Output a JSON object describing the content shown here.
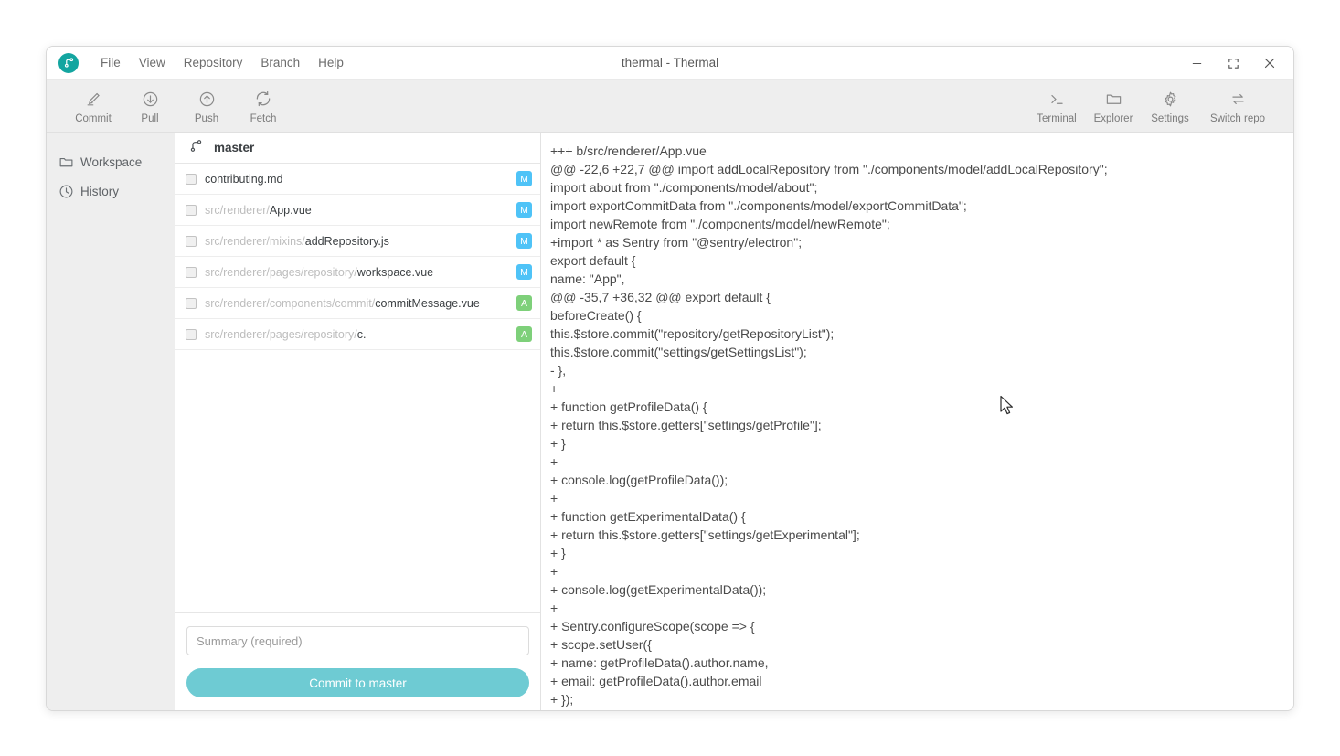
{
  "window": {
    "title": "thermal - Thermal",
    "logo_icon": "git-branch-logo-icon",
    "minimize_label": "–",
    "maximize_label": "maximize-icon",
    "close_label": "×"
  },
  "menubar": {
    "items": [
      {
        "label": "File"
      },
      {
        "label": "View"
      },
      {
        "label": "Repository"
      },
      {
        "label": "Branch"
      },
      {
        "label": "Help"
      }
    ]
  },
  "toolbar": {
    "left": [
      {
        "label": "Commit",
        "icon": "pencil-icon"
      },
      {
        "label": "Pull",
        "icon": "arrow-down-circle-icon"
      },
      {
        "label": "Push",
        "icon": "arrow-up-circle-icon"
      },
      {
        "label": "Fetch",
        "icon": "refresh-icon"
      }
    ],
    "right": [
      {
        "label": "Terminal",
        "icon": "terminal-icon"
      },
      {
        "label": "Explorer",
        "icon": "folder-icon"
      },
      {
        "label": "Settings",
        "icon": "gear-icon"
      },
      {
        "label": "Switch repo",
        "icon": "swap-arrows-icon"
      }
    ]
  },
  "sidebar": {
    "items": [
      {
        "label": "Workspace",
        "icon": "folder-icon"
      },
      {
        "label": "History",
        "icon": "clock-icon"
      }
    ]
  },
  "branch": {
    "icon": "git-branch-icon",
    "name": "master"
  },
  "files": [
    {
      "dir": "",
      "base": "contributing.md",
      "status": "M",
      "checked": false
    },
    {
      "dir": "src/renderer/",
      "base": "App.vue",
      "status": "M",
      "checked": false
    },
    {
      "dir": "src/renderer/mixins/",
      "base": "addRepository.js",
      "status": "M",
      "checked": false
    },
    {
      "dir": "src/renderer/pages/repository/",
      "base": "workspace.vue",
      "status": "M",
      "checked": false
    },
    {
      "dir": "src/renderer/components/commit/",
      "base": "commitMessage.vue",
      "status": "A",
      "checked": false
    },
    {
      "dir": "src/renderer/pages/repository/",
      "base": "c.",
      "status": "A",
      "checked": false
    }
  ],
  "commit": {
    "summary_value": "",
    "summary_placeholder": "Summary (required)",
    "button_label": "Commit to master"
  },
  "diff": {
    "lines": [
      "+++ b/src/renderer/App.vue",
      "@@ -22,6 +22,7 @@ import addLocalRepository from \"./components/model/addLocalRepository\";",
      "import about from \"./components/model/about\";",
      "import exportCommitData from \"./components/model/exportCommitData\";",
      "import newRemote from \"./components/model/newRemote\";",
      "+import * as Sentry from \"@sentry/electron\";",
      "export default {",
      "name: \"App\",",
      "@@ -35,7 +36,32 @@ export default {",
      "beforeCreate() {",
      "this.$store.commit(\"repository/getRepositoryList\");",
      "this.$store.commit(\"settings/getSettingsList\");",
      "- },",
      "+",
      "+ function getProfileData() {",
      "+ return this.$store.getters[\"settings/getProfile\"];",
      "+ }",
      "+",
      "+ console.log(getProfileData());",
      "+",
      "+ function getExperimentalData() {",
      "+ return this.$store.getters[\"settings/getExperimental\"];",
      "+ }",
      "+",
      "+ console.log(getExperimentalData());",
      "+",
      "+ Sentry.configureScope(scope => {",
      "+ scope.setUser({",
      "+ name: getProfileData().author.name,",
      "+ email: getProfileData().author.email",
      "+ });"
    ]
  },
  "colors": {
    "accent_teal": "#6ecbd3",
    "logo_teal": "#13a5a0",
    "badge_modified": "#4fc3f7",
    "badge_added": "#7ed07a",
    "toolbar_bg": "#eeeeee"
  }
}
